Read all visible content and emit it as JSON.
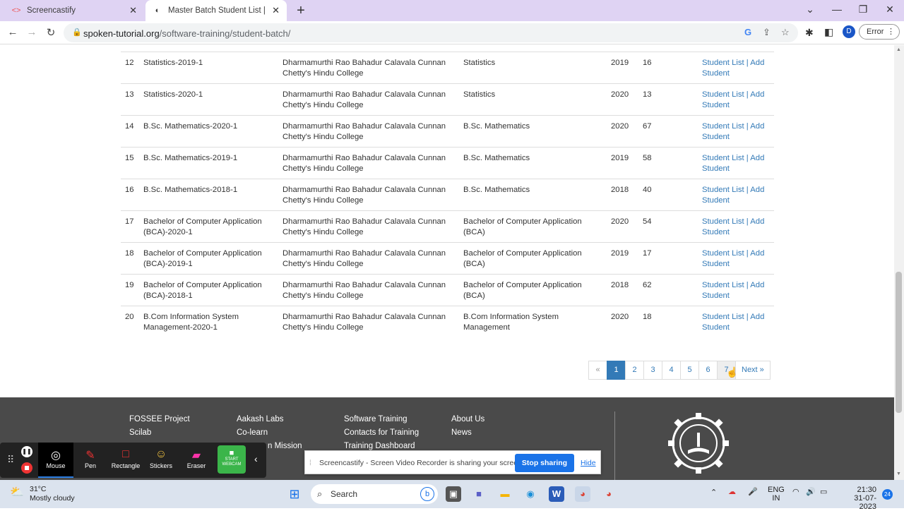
{
  "browser": {
    "tabs": [
      {
        "title": "Screencastify"
      },
      {
        "title": "Master Batch Student List | spok"
      }
    ],
    "url_host": "spoken-tutorial.org",
    "url_path": "/software-training/student-batch/",
    "profile_initial": "D",
    "error_label": "Error"
  },
  "table": {
    "partial_row": "",
    "rows": [
      {
        "no": "12",
        "batch": "Statistics-2019-1",
        "institute": "Dharmamurthi Rao Bahadur Calavala Cunnan Chetty's Hindu College",
        "department": "Statistics",
        "year": "2019",
        "count": "16",
        "actions": "Student List | Add Student"
      },
      {
        "no": "13",
        "batch": "Statistics-2020-1",
        "institute": "Dharmamurthi Rao Bahadur Calavala Cunnan Chetty's Hindu College",
        "department": "Statistics",
        "year": "2020",
        "count": "13",
        "actions": "Student List | Add Student"
      },
      {
        "no": "14",
        "batch": "B.Sc. Mathematics-2020-1",
        "institute": "Dharmamurthi Rao Bahadur Calavala Cunnan Chetty's Hindu College",
        "department": "B.Sc. Mathematics",
        "year": "2020",
        "count": "67",
        "actions": "Student List | Add Student"
      },
      {
        "no": "15",
        "batch": "B.Sc. Mathematics-2019-1",
        "institute": "Dharmamurthi Rao Bahadur Calavala Cunnan Chetty's Hindu College",
        "department": "B.Sc. Mathematics",
        "year": "2019",
        "count": "58",
        "actions": "Student List | Add Student"
      },
      {
        "no": "16",
        "batch": "B.Sc. Mathematics-2018-1",
        "institute": "Dharmamurthi Rao Bahadur Calavala Cunnan Chetty's Hindu College",
        "department": "B.Sc. Mathematics",
        "year": "2018",
        "count": "40",
        "actions": "Student List | Add Student"
      },
      {
        "no": "17",
        "batch": "Bachelor of Computer Application (BCA)-2020-1",
        "institute": "Dharmamurthi Rao Bahadur Calavala Cunnan Chetty's Hindu College",
        "department": "Bachelor of Computer Application (BCA)",
        "year": "2020",
        "count": "54",
        "actions": "Student List | Add Student"
      },
      {
        "no": "18",
        "batch": "Bachelor of Computer Application (BCA)-2019-1",
        "institute": "Dharmamurthi Rao Bahadur Calavala Cunnan Chetty's Hindu College",
        "department": "Bachelor of Computer Application (BCA)",
        "year": "2019",
        "count": "17",
        "actions": "Student List | Add Student"
      },
      {
        "no": "19",
        "batch": "Bachelor of Computer Application (BCA)-2018-1",
        "institute": "Dharmamurthi Rao Bahadur Calavala Cunnan Chetty's Hindu College",
        "department": "Bachelor of Computer Application (BCA)",
        "year": "2018",
        "count": "62",
        "actions": "Student List | Add Student"
      },
      {
        "no": "20",
        "batch": "B.Com Information System Management-2020-1",
        "institute": "Dharmamurthi Rao Bahadur Calavala Cunnan Chetty's Hindu College",
        "department": "B.Com Information System Management",
        "year": "2020",
        "count": "18",
        "actions": "Student List | Add Student"
      }
    ]
  },
  "pagination": {
    "prev": "«",
    "pages": [
      "1",
      "2",
      "3",
      "4",
      "5",
      "6",
      "7"
    ],
    "active": "1",
    "next": "Next »"
  },
  "footer": {
    "col1": [
      "FOSSEE Project",
      "Scilab"
    ],
    "col2": [
      "Aakash Labs",
      "Co-learn",
      "n Mission"
    ],
    "col3": [
      "Software Training",
      "Contacts for Training",
      "Training Dashboard"
    ],
    "col4": [
      "About Us",
      "News"
    ]
  },
  "screencastify": {
    "tools": [
      "Mouse",
      "Pen",
      "Rectangle",
      "Stickers",
      "Eraser"
    ],
    "webcam_label": "START WEBCAM",
    "share_message": "Screencastify - Screen Video Recorder is sharing your screen.",
    "stop_sharing": "Stop sharing",
    "hide": "Hide"
  },
  "taskbar": {
    "temp": "31°C",
    "weather": "Mostly cloudy",
    "search_placeholder": "Search",
    "lang1": "ENG",
    "lang2": "IN",
    "time": "21:30",
    "date": "31-07-2023",
    "notifications": "24"
  },
  "colors": {
    "link": "#337ab7",
    "footer": "#4a4a4a",
    "tabstrip": "#dfd3f3"
  }
}
